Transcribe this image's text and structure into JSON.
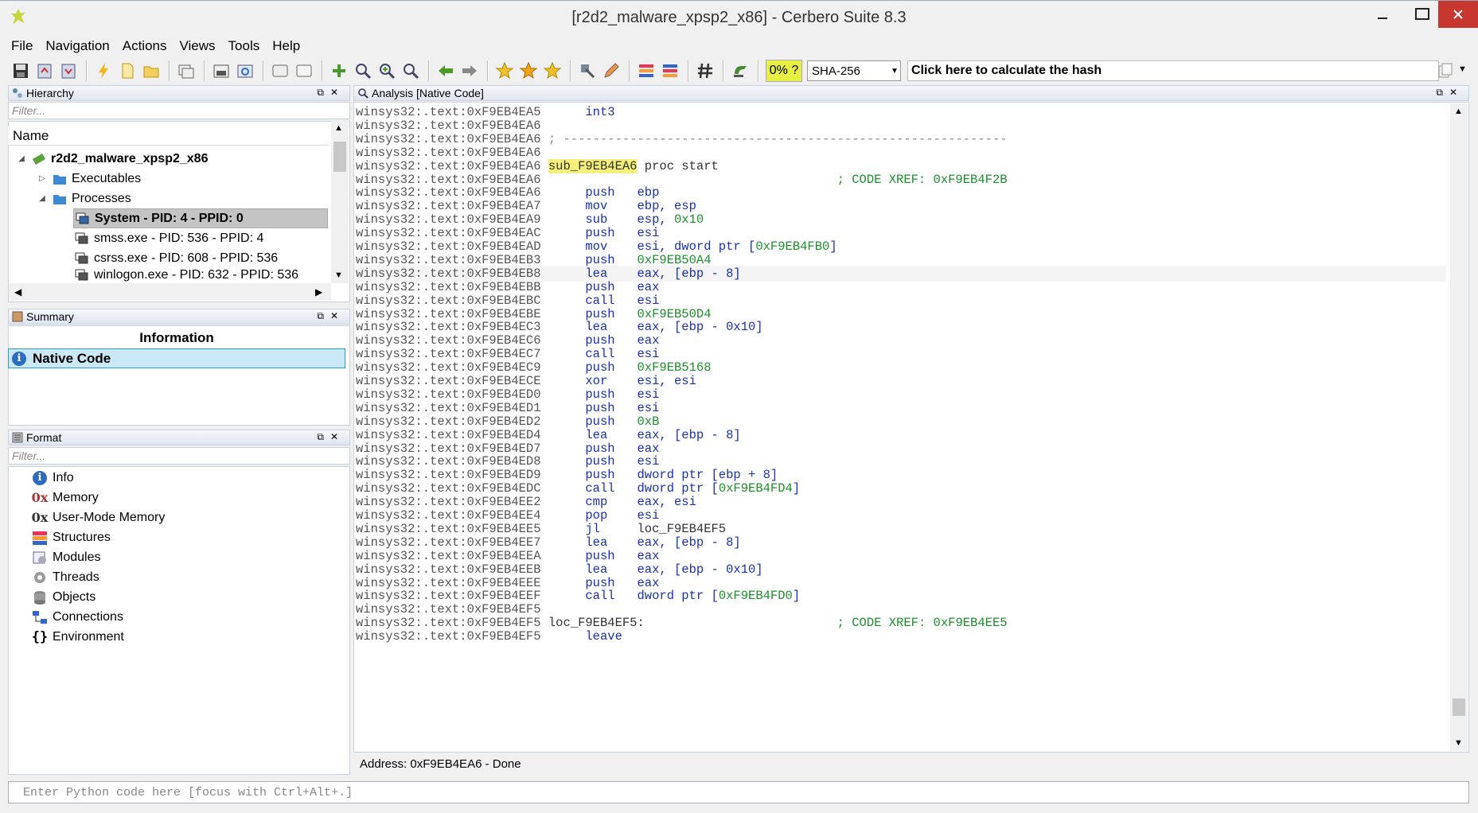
{
  "window": {
    "title": "[r2d2_malware_xpsp2_x86] - Cerbero Suite 8.3"
  },
  "menu": [
    "File",
    "Navigation",
    "Actions",
    "Views",
    "Tools",
    "Help"
  ],
  "toolbar": {
    "progress": "0% ?",
    "hash_algo": "SHA-256",
    "hash_button": "Click here to calculate the hash"
  },
  "hierarchy": {
    "title": "Hierarchy",
    "filter_placeholder": "Filter...",
    "column": "Name",
    "root": "r2d2_malware_xpsp2_x86",
    "executables": "Executables",
    "processes": "Processes",
    "items": [
      "System - PID: 4 - PPID: 0",
      "smss.exe - PID: 536 - PPID: 4",
      "csrss.exe - PID: 608 - PPID: 536",
      "winlogon.exe - PID: 632 - PPID: 536"
    ]
  },
  "summary": {
    "title": "Summary",
    "header": "Information",
    "item": "Native Code"
  },
  "format": {
    "title": "Format",
    "filter_placeholder": "Filter...",
    "items": [
      "Info",
      "Memory",
      "User-Mode Memory",
      "Structures",
      "Modules",
      "Threads",
      "Objects",
      "Connections",
      "Environment"
    ]
  },
  "analysis": {
    "title": "Analysis [Native Code]",
    "status": "Address: 0xF9EB4EA6 - Done",
    "lines": [
      {
        "addr": "winsys32:.text:0xF9EB4EA5",
        "op": "int3",
        "args": ""
      },
      {
        "addr": "winsys32:.text:0xF9EB4EA6",
        "op": "",
        "args": ""
      },
      {
        "addr": "winsys32:.text:0xF9EB4EA6",
        "dash": "; ------------------------------------------------------------"
      },
      {
        "addr": "winsys32:.text:0xF9EB4EA6",
        "op": "",
        "args": ""
      },
      {
        "addr": "winsys32:.text:0xF9EB4EA6",
        "sub": "sub_F9EB4EA6",
        "rest": " proc start"
      },
      {
        "addr": "winsys32:.text:0xF9EB4EA6",
        "comment": "; CODE XREF: 0xF9EB4F2B"
      },
      {
        "addr": "winsys32:.text:0xF9EB4EA6",
        "op": "push",
        "args": "ebp"
      },
      {
        "addr": "winsys32:.text:0xF9EB4EA7",
        "op": "mov",
        "args": "ebp, esp"
      },
      {
        "addr": "winsys32:.text:0xF9EB4EA9",
        "op": "sub",
        "args": "esp, ",
        "num": "0x10"
      },
      {
        "addr": "winsys32:.text:0xF9EB4EAC",
        "op": "push",
        "args": "esi"
      },
      {
        "addr": "winsys32:.text:0xF9EB4EAD",
        "op": "mov",
        "args": "esi, dword ptr [",
        "num": "0xF9EB4FB0",
        "tail": "]"
      },
      {
        "addr": "winsys32:.text:0xF9EB4EB3",
        "op": "push",
        "args": "",
        "num": "0xF9EB50A4"
      },
      {
        "addr": "winsys32:.text:0xF9EB4EB8",
        "op": "lea",
        "args": "eax, [ebp - 8]",
        "hl": true
      },
      {
        "addr": "winsys32:.text:0xF9EB4EBB",
        "op": "push",
        "args": "eax"
      },
      {
        "addr": "winsys32:.text:0xF9EB4EBC",
        "op": "call",
        "args": "esi"
      },
      {
        "addr": "winsys32:.text:0xF9EB4EBE",
        "op": "push",
        "args": "",
        "num": "0xF9EB50D4"
      },
      {
        "addr": "winsys32:.text:0xF9EB4EC3",
        "op": "lea",
        "args": "eax, [ebp - 0x10]"
      },
      {
        "addr": "winsys32:.text:0xF9EB4EC6",
        "op": "push",
        "args": "eax"
      },
      {
        "addr": "winsys32:.text:0xF9EB4EC7",
        "op": "call",
        "args": "esi"
      },
      {
        "addr": "winsys32:.text:0xF9EB4EC9",
        "op": "push",
        "args": "",
        "num": "0xF9EB5168"
      },
      {
        "addr": "winsys32:.text:0xF9EB4ECE",
        "op": "xor",
        "args": "esi, esi"
      },
      {
        "addr": "winsys32:.text:0xF9EB4ED0",
        "op": "push",
        "args": "esi"
      },
      {
        "addr": "winsys32:.text:0xF9EB4ED1",
        "op": "push",
        "args": "esi"
      },
      {
        "addr": "winsys32:.text:0xF9EB4ED2",
        "op": "push",
        "args": "",
        "num": "0xB"
      },
      {
        "addr": "winsys32:.text:0xF9EB4ED4",
        "op": "lea",
        "args": "eax, [ebp - 8]"
      },
      {
        "addr": "winsys32:.text:0xF9EB4ED7",
        "op": "push",
        "args": "eax"
      },
      {
        "addr": "winsys32:.text:0xF9EB4ED8",
        "op": "push",
        "args": "esi"
      },
      {
        "addr": "winsys32:.text:0xF9EB4ED9",
        "op": "push",
        "args": "dword ptr [ebp + 8]"
      },
      {
        "addr": "winsys32:.text:0xF9EB4EDC",
        "op": "call",
        "args": "dword ptr [",
        "num": "0xF9EB4FD4",
        "tail": "]"
      },
      {
        "addr": "winsys32:.text:0xF9EB4EE2",
        "op": "cmp",
        "args": "eax, esi"
      },
      {
        "addr": "winsys32:.text:0xF9EB4EE4",
        "op": "pop",
        "args": "esi"
      },
      {
        "addr": "winsys32:.text:0xF9EB4EE5",
        "op": "jl",
        "lbl": "loc_F9EB4EF5"
      },
      {
        "addr": "winsys32:.text:0xF9EB4EE7",
        "op": "lea",
        "args": "eax, [ebp - 8]"
      },
      {
        "addr": "winsys32:.text:0xF9EB4EEA",
        "op": "push",
        "args": "eax"
      },
      {
        "addr": "winsys32:.text:0xF9EB4EEB",
        "op": "lea",
        "args": "eax, [ebp - 0x10]"
      },
      {
        "addr": "winsys32:.text:0xF9EB4EEE",
        "op": "push",
        "args": "eax"
      },
      {
        "addr": "winsys32:.text:0xF9EB4EEF",
        "op": "call",
        "args": "dword ptr [",
        "num": "0xF9EB4FD0",
        "tail": "]"
      },
      {
        "addr": "winsys32:.text:0xF9EB4EF5",
        "op": "",
        "args": ""
      },
      {
        "addr": "winsys32:.text:0xF9EB4EF5",
        "label": "loc_F9EB4EF5:",
        "comment2": "; CODE XREF: 0xF9EB4EE5"
      },
      {
        "addr": "winsys32:.text:0xF9EB4EF5",
        "op": "leave",
        "args": ""
      }
    ]
  },
  "python": {
    "placeholder": "Enter Python code here [focus with Ctrl+Alt+.]"
  }
}
